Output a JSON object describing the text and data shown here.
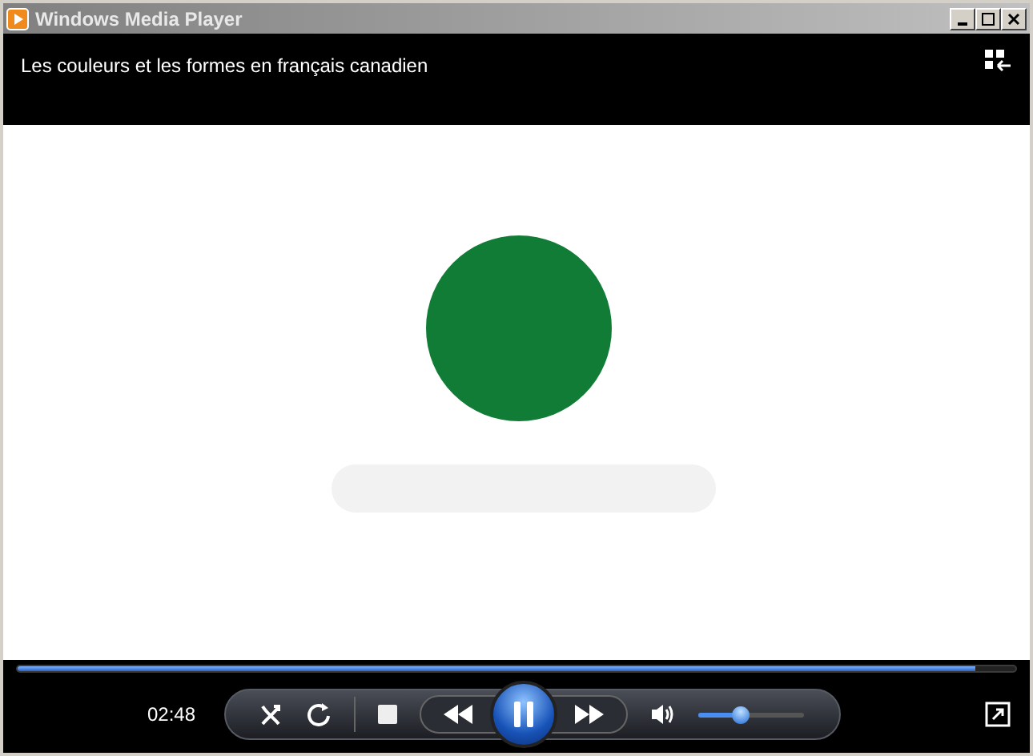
{
  "window": {
    "title": "Windows Media Player"
  },
  "media_title": "Les couleurs et les formes en français canadien",
  "seek": {
    "level": 0.96
  },
  "time": "02:48",
  "playing": true,
  "volume": {
    "level": 0.4
  }
}
